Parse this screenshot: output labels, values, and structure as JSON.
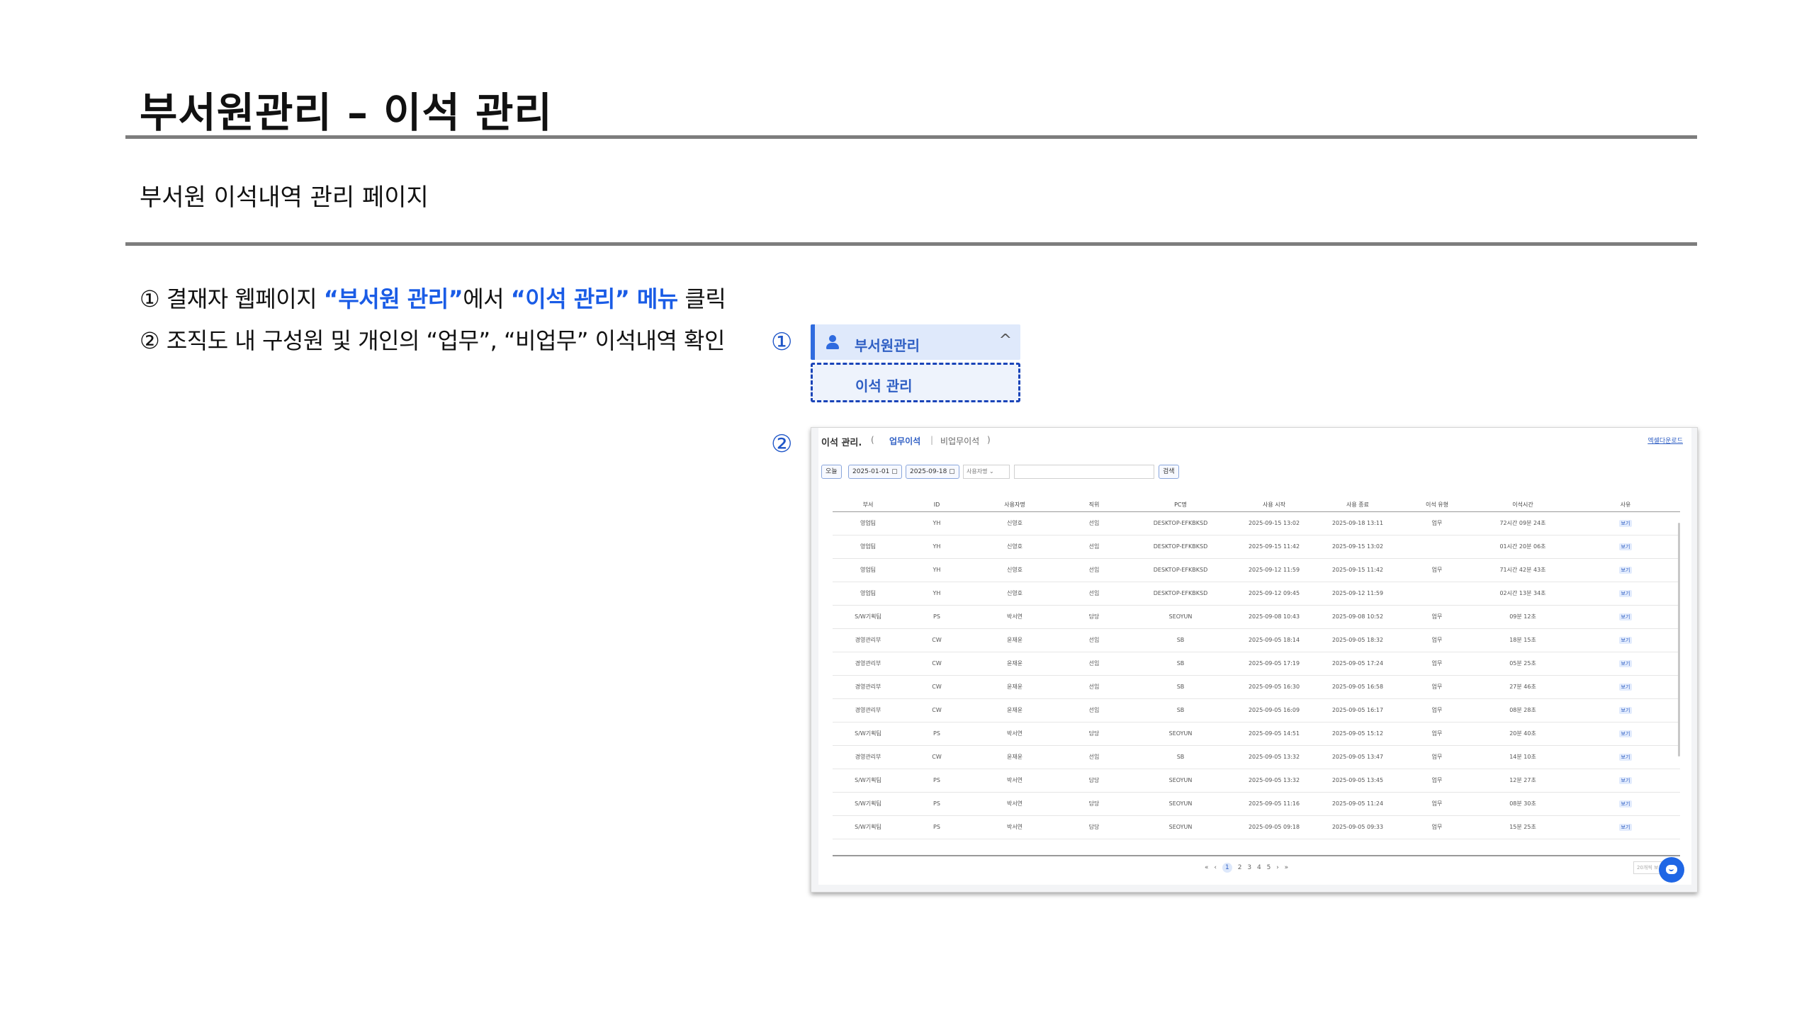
{
  "page": {
    "title": "부서원관리 – 이석 관리",
    "subtitle": "부서원 이석내역 관리 페이지"
  },
  "steps": [
    {
      "num": "①",
      "prefix": " 결재자 웹페이지 ",
      "hl1": "“부서원 관리”",
      "mid": "에서 ",
      "hl2": "“이석 관리” 메뉴",
      "suffix": " 클릭"
    },
    {
      "num": "②",
      "text": " 조직도 내 구성원 및 개인의 “업무”, “비업무” 이석내역 확인"
    }
  ],
  "markers": {
    "m1": "①",
    "m2": "②"
  },
  "menu": {
    "group_label": "부서원관리",
    "chevron": "^",
    "item_label": "이석 관리"
  },
  "panel": {
    "title": "이석 관리.",
    "paren_open": "(",
    "tab_work": "업무이석",
    "tab_sep": "|",
    "tab_nonwork": "비업무이석",
    "paren_close": ")",
    "excel": "엑셀다운로드",
    "filters": {
      "today": "오늘",
      "date_from": "2025-01-01 ▢",
      "date_to": "2025-09-18 ▢",
      "select": "사용자명 ⌄",
      "search": "검색"
    },
    "table": {
      "headers": [
        "부서",
        "ID",
        "사용자명",
        "직위",
        "PC명",
        "사용 시작",
        "사용 종료",
        "이석 유형",
        "이석시간",
        "사유"
      ],
      "rows": [
        [
          "영업팀",
          "YH",
          "신영호",
          "선임",
          "DESKTOP-EFKBKSD",
          "2025-09-15 13:02",
          "2025-09-18 13:11",
          "업무",
          "72시간 09분 24초",
          "보기"
        ],
        [
          "영업팀",
          "YH",
          "신영호",
          "선임",
          "DESKTOP-EFKBKSD",
          "2025-09-15 11:42",
          "2025-09-15 13:02",
          "",
          "01시간 20분 06초",
          "보기"
        ],
        [
          "영업팀",
          "YH",
          "신영호",
          "선임",
          "DESKTOP-EFKBKSD",
          "2025-09-12 11:59",
          "2025-09-15 11:42",
          "업무",
          "71시간 42분 43초",
          "보기"
        ],
        [
          "영업팀",
          "YH",
          "신영호",
          "선임",
          "DESKTOP-EFKBKSD",
          "2025-09-12 09:45",
          "2025-09-12 11:59",
          "",
          "02시간 13분 34초",
          "보기"
        ],
        [
          "S/W기획팀",
          "PS",
          "박서연",
          "담당",
          "SEOYUN",
          "2025-09-08 10:43",
          "2025-09-08 10:52",
          "업무",
          "09분 12초",
          "보기"
        ],
        [
          "경영관리부",
          "CW",
          "윤재윤",
          "선임",
          "SB",
          "2025-09-05 18:14",
          "2025-09-05 18:32",
          "업무",
          "18분 15초",
          "보기"
        ],
        [
          "경영관리부",
          "CW",
          "윤재윤",
          "선임",
          "SB",
          "2025-09-05 17:19",
          "2025-09-05 17:24",
          "업무",
          "05분 25초",
          "보기"
        ],
        [
          "경영관리부",
          "CW",
          "윤재윤",
          "선임",
          "SB",
          "2025-09-05 16:30",
          "2025-09-05 16:58",
          "업무",
          "27분 46초",
          "보기"
        ],
        [
          "경영관리부",
          "CW",
          "윤재윤",
          "선임",
          "SB",
          "2025-09-05 16:09",
          "2025-09-05 16:17",
          "업무",
          "08분 28초",
          "보기"
        ],
        [
          "S/W기획팀",
          "PS",
          "박서연",
          "담당",
          "SEOYUN",
          "2025-09-05 14:51",
          "2025-09-05 15:12",
          "업무",
          "20분 40초",
          "보기"
        ],
        [
          "경영관리부",
          "CW",
          "윤재윤",
          "선임",
          "SB",
          "2025-09-05 13:32",
          "2025-09-05 13:47",
          "업무",
          "14분 10초",
          "보기"
        ],
        [
          "S/W기획팀",
          "PS",
          "박서연",
          "담당",
          "SEOYUN",
          "2025-09-05 13:32",
          "2025-09-05 13:45",
          "업무",
          "12분 27초",
          "보기"
        ],
        [
          "S/W기획팀",
          "PS",
          "박서연",
          "담당",
          "SEOYUN",
          "2025-09-05 11:16",
          "2025-09-05 11:24",
          "업무",
          "08분 30초",
          "보기"
        ],
        [
          "S/W기획팀",
          "PS",
          "박서연",
          "담당",
          "SEOYUN",
          "2025-09-05 09:18",
          "2025-09-05 09:33",
          "업무",
          "15분 25초",
          "보기"
        ]
      ]
    },
    "pager": {
      "first": "«",
      "prev": "‹",
      "pages": [
        "1",
        "2",
        "3",
        "4",
        "5"
      ],
      "next": "›",
      "last": "»",
      "page_size": "20개씩 보기"
    },
    "chat_icon": "chat-bubble-icon"
  }
}
